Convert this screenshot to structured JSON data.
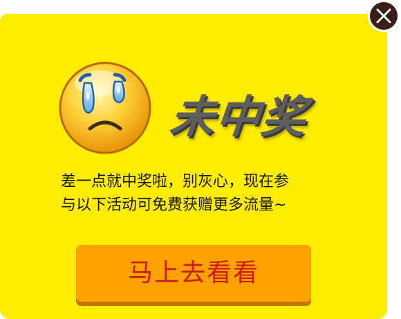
{
  "popup": {
    "title": "未中奖",
    "message_line1": "差一点就中奖啦，别灰心，现在参",
    "message_line2": "与以下活动可免费获赠更多流量~",
    "cta_label": "马上去看看"
  },
  "icons": {
    "close": "close-icon",
    "face": "crying-face-icon"
  },
  "colors": {
    "background": "#ffec00",
    "cta": "#ffa200",
    "cta_text": "#cc1b0e",
    "title": "#5e5e5e"
  }
}
